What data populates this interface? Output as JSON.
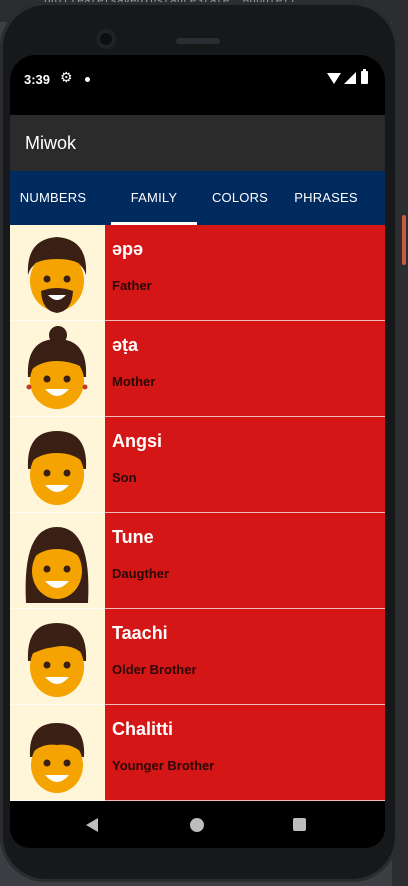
{
  "ide": {
    "code_fragment": "on(create(savedInstanceState: Bundle?)"
  },
  "status_bar": {
    "time": "3:39",
    "icons": [
      "gear-icon",
      "dot-icon",
      "wifi-icon",
      "signal-icon",
      "battery-icon"
    ]
  },
  "app_bar": {
    "title": "Miwok"
  },
  "tabs": [
    {
      "label": "NUMBERS",
      "active": false
    },
    {
      "label": "FAMILY",
      "active": true
    },
    {
      "label": "COLORS",
      "active": false
    },
    {
      "label": "PHRASES",
      "active": false
    }
  ],
  "colors": {
    "tab_bar": "#012a5e",
    "row_background": "#d51616",
    "image_background": "#fff6d9",
    "app_bar": "#2b2b2b"
  },
  "words": [
    {
      "miwok": "əpə",
      "english": "Father",
      "icon": "father-icon"
    },
    {
      "miwok": "əṭa",
      "english": "Mother",
      "icon": "mother-icon"
    },
    {
      "miwok": "Angsi",
      "english": "Son",
      "icon": "son-icon"
    },
    {
      "miwok": "Tune",
      "english": "Daugther",
      "icon": "daughter-icon"
    },
    {
      "miwok": "Taachi",
      "english": "Older Brother",
      "icon": "older-brother-icon"
    },
    {
      "miwok": "Chalitti",
      "english": "Younger Brother",
      "icon": "younger-brother-icon"
    }
  ],
  "nav_bar": {
    "buttons": [
      "back-icon",
      "home-icon",
      "recents-icon"
    ]
  }
}
